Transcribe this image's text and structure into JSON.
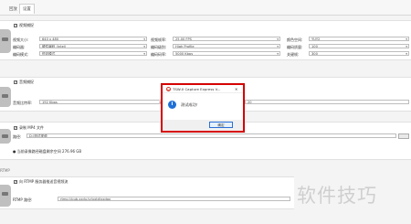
{
  "tabs": [
    {
      "label": "回放"
    },
    {
      "label": "设置"
    }
  ],
  "video": {
    "section_label": "视频捕捉",
    "video_size_label": "视频大小:",
    "video_size_value": "640 x 480",
    "frame_rate_label": "视频帧率:",
    "frame_rate_value": "25.00 FPS",
    "color_space_label": "颜色空间:",
    "color_space_value": "YUY2",
    "encoder_label": "编码器:",
    "encoder_value": "硬件编码 (Intel)",
    "level_label": "编码级别:",
    "level_value": "High Profile",
    "quality_label": "编码质量:",
    "quality_value": "100",
    "mode_label": "编码模式:",
    "mode_value": "恒定模式",
    "bitrate_label": "编码码率:",
    "bitrate_value": "5000 Kbps",
    "keyframe_label": "关键帧:",
    "keyframe_value": "300"
  },
  "audio": {
    "section_label": "音频捕捉",
    "sample_rate_label": "音频比特率:",
    "sample_rate_value": "192 Kbps",
    "right_value": "20"
  },
  "record": {
    "section_label": "录制 MP4 文件",
    "path_label": "路径:",
    "path_value": "D:\\测试视频",
    "space_text": "● 当前录像路径磁盘剩余空间 276.96 GB"
  },
  "rtmp": {
    "left_label": "RTMP",
    "section_label": "向 RTMP 服务器推送音视频流",
    "url_label": "RTMP 路径:",
    "url_value": "rtmp://pub.xxdu.tv/xxtd/xxdgx"
  },
  "dialog": {
    "title": "TSW-II Capture Express V...",
    "close_glyph": "✕",
    "info_glyph": "i",
    "message": "测试成功！",
    "ok_label": "确定"
  },
  "watermark": "软件技巧"
}
